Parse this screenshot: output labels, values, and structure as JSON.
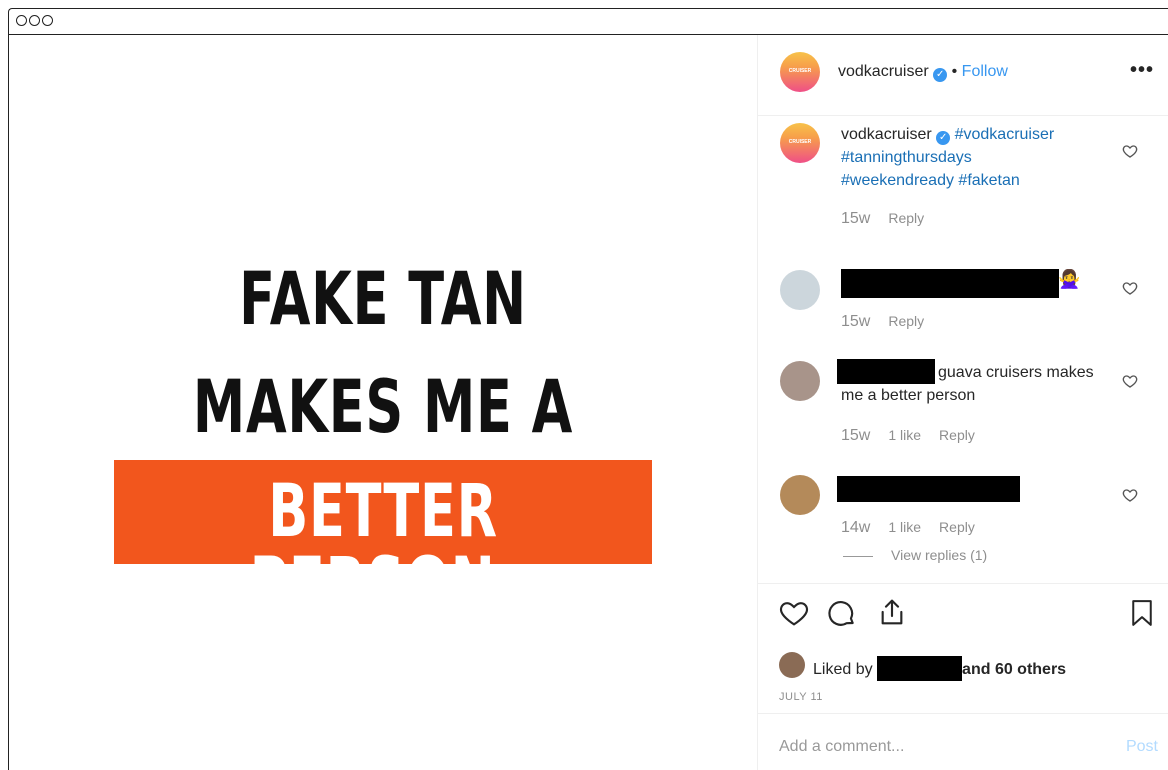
{
  "media": {
    "line1": "FAKE TAN",
    "line2": "MAKES ME A",
    "banner": "BETTER PERSON.",
    "banner_color": "#f2561d"
  },
  "header": {
    "username": "vodkacruiser",
    "avatar_text": "CRUISER",
    "separator": "•",
    "follow_label": "Follow",
    "more_label": "•••"
  },
  "caption": {
    "username": "vodkacruiser",
    "hashtag_line1": "#vodkacruiser",
    "hashtag_line2": "#tanningthursdays",
    "hashtag_line3": "#weekendready #faketan",
    "time": "15w",
    "reply": "Reply"
  },
  "comments": [
    {
      "emoji": "🙅‍♀️",
      "time": "15w",
      "reply": "Reply"
    },
    {
      "text1": "guava cruisers makes",
      "text2": "me a better person",
      "time": "15w",
      "likes": "1 like",
      "reply": "Reply"
    },
    {
      "time": "14w",
      "likes": "1 like",
      "reply": "Reply",
      "view_replies": "View replies (1)"
    }
  ],
  "actions": {
    "liked_by": "Liked by",
    "and_others": "and 60 others",
    "date": "JULY 11"
  },
  "add_comment": {
    "placeholder": "Add a comment...",
    "post_label": "Post"
  },
  "colors": {
    "link": "#1a6fb5",
    "follow": "#3897f0",
    "verified": "#3897f0"
  },
  "icons": [
    "heart-icon",
    "comment-icon",
    "share-icon",
    "bookmark-icon",
    "verified-badge-icon",
    "more-icon"
  ]
}
